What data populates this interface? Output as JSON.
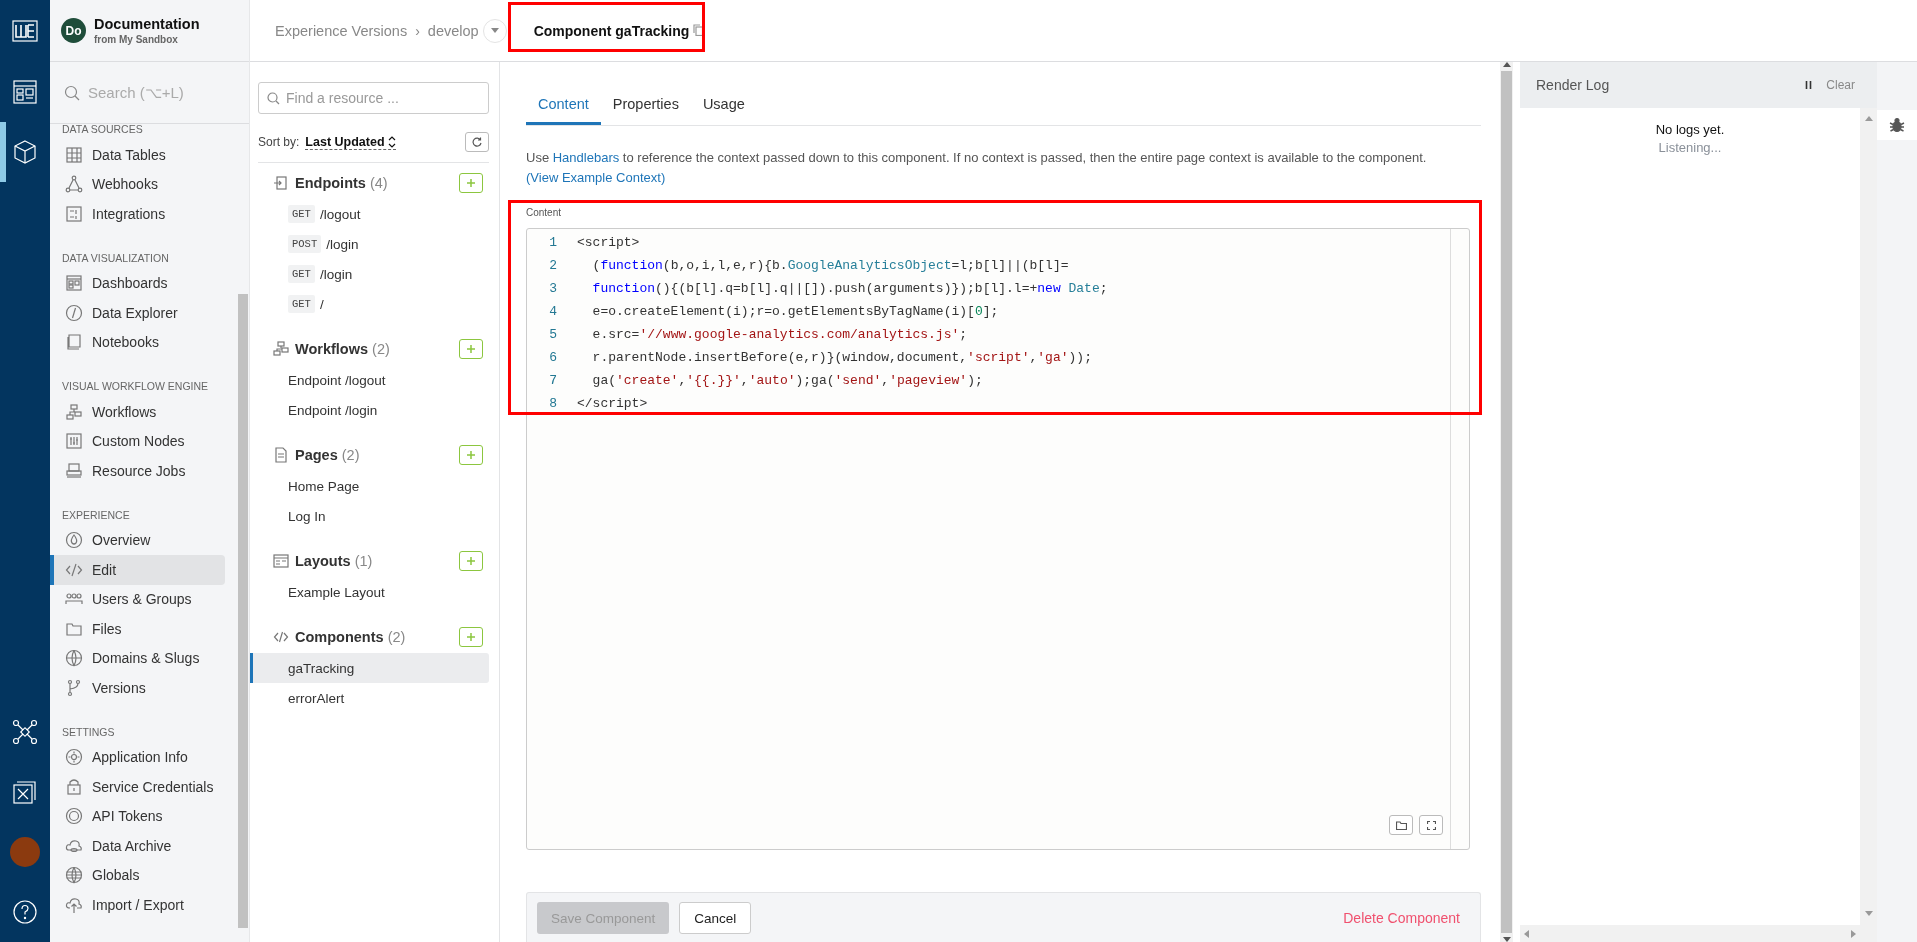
{
  "rail": {
    "items": [
      {
        "selected": false
      },
      {
        "selected": true
      }
    ]
  },
  "app": {
    "initials": "Do",
    "name": "Documentation",
    "subtitle": "from My Sandbox"
  },
  "sidebar": {
    "search": {
      "placeholder": "Search (⌥+L)"
    },
    "sections": [
      {
        "heading": "DATA SOURCES",
        "items": [
          {
            "label": "Data Tables",
            "selected": false
          },
          {
            "label": "Webhooks",
            "selected": false
          },
          {
            "label": "Integrations",
            "selected": false
          }
        ]
      },
      {
        "heading": "DATA VISUALIZATION",
        "items": [
          {
            "label": "Dashboards",
            "selected": false
          },
          {
            "label": "Data Explorer",
            "selected": false
          },
          {
            "label": "Notebooks",
            "selected": false
          }
        ]
      },
      {
        "heading": "VISUAL WORKFLOW ENGINE",
        "items": [
          {
            "label": "Workflows",
            "selected": false
          },
          {
            "label": "Custom Nodes",
            "selected": false
          },
          {
            "label": "Resource Jobs",
            "selected": false
          }
        ]
      },
      {
        "heading": "EXPERIENCE",
        "items": [
          {
            "label": "Overview",
            "selected": false
          },
          {
            "label": "Edit",
            "selected": true
          },
          {
            "label": "Users & Groups",
            "selected": false
          },
          {
            "label": "Files",
            "selected": false
          },
          {
            "label": "Domains & Slugs",
            "selected": false
          },
          {
            "label": "Versions",
            "selected": false
          }
        ]
      },
      {
        "heading": "SETTINGS",
        "items": [
          {
            "label": "Application Info",
            "selected": false
          },
          {
            "label": "Service Credentials",
            "selected": false
          },
          {
            "label": "API Tokens",
            "selected": false
          },
          {
            "label": "Data Archive",
            "selected": false
          },
          {
            "label": "Globals",
            "selected": false
          },
          {
            "label": "Import / Export",
            "selected": false
          }
        ]
      }
    ]
  },
  "breadcrumb": {
    "items": [
      "Experience Versions",
      "develop"
    ],
    "separator": "›"
  },
  "page_title": "Component gaTracking",
  "resources": {
    "search": {
      "placeholder": "Find a resource ..."
    },
    "sort_label": "Sort by:",
    "sort_value": "Last Updated",
    "groups": [
      {
        "title": "Endpoints",
        "count": "(4)",
        "items": [
          {
            "method": "GET",
            "label": "/logout",
            "selected": false
          },
          {
            "method": "POST",
            "label": "/login",
            "selected": false
          },
          {
            "method": "GET",
            "label": "/login",
            "selected": false
          },
          {
            "method": "GET",
            "label": "/",
            "selected": false
          }
        ]
      },
      {
        "title": "Workflows",
        "count": "(2)",
        "items": [
          {
            "label": "Endpoint /logout",
            "selected": false
          },
          {
            "label": "Endpoint /login",
            "selected": false
          }
        ]
      },
      {
        "title": "Pages",
        "count": "(2)",
        "items": [
          {
            "label": "Home Page",
            "selected": false
          },
          {
            "label": "Log In",
            "selected": false
          }
        ]
      },
      {
        "title": "Layouts",
        "count": "(1)",
        "items": [
          {
            "label": "Example Layout",
            "selected": false
          }
        ]
      },
      {
        "title": "Components",
        "count": "(2)",
        "items": [
          {
            "label": "gaTracking",
            "selected": true
          },
          {
            "label": "errorAlert",
            "selected": false
          }
        ]
      }
    ]
  },
  "tabs": [
    {
      "label": "Content",
      "selected": true
    },
    {
      "label": "Properties",
      "selected": false
    },
    {
      "label": "Usage",
      "selected": false
    }
  ],
  "help_text": {
    "before": "Use ",
    "link": "Handlebars",
    "after": " to reference the context passed down to this component. If no context is passed, then the entire page context is available to the component."
  },
  "example_link": "(View Example Context)",
  "editor": {
    "label": "Content",
    "lines": [
      {
        "number": "1",
        "tokens": [
          {
            "text": "<script>",
            "kind": "plain"
          }
        ]
      },
      {
        "number": "2",
        "tokens": [
          {
            "text": "  (",
            "kind": "plain"
          },
          {
            "text": "function",
            "kind": "keyword"
          },
          {
            "text": "(b,o,i,l,e,r){b.",
            "kind": "plain"
          },
          {
            "text": "GoogleAnalyticsObject",
            "kind": "type"
          },
          {
            "text": "=l;b[l]||(b[l]=",
            "kind": "plain"
          }
        ]
      },
      {
        "number": "3",
        "tokens": [
          {
            "text": "  function",
            "kind": "keyword"
          },
          {
            "text": "(){(b[l].q=b[l].q||[]).push(arguments)});b[l].l=+",
            "kind": "plain"
          },
          {
            "text": "new",
            "kind": "keyword"
          },
          {
            "text": " Date",
            "kind": "type"
          },
          {
            "text": ";",
            "kind": "plain"
          }
        ]
      },
      {
        "number": "4",
        "tokens": [
          {
            "text": "  e=o.createElement(i);r=o.getElementsByTagName(i)[",
            "kind": "plain"
          },
          {
            "text": "0",
            "kind": "number"
          },
          {
            "text": "];",
            "kind": "plain"
          }
        ]
      },
      {
        "number": "5",
        "tokens": [
          {
            "text": "  e.src=",
            "kind": "plain"
          },
          {
            "text": "'//www.google-analytics.com/analytics.js'",
            "kind": "string"
          },
          {
            "text": ";",
            "kind": "plain"
          }
        ]
      },
      {
        "number": "6",
        "tokens": [
          {
            "text": "  r.parentNode.insertBefore(e,r)}(window,document,",
            "kind": "plain"
          },
          {
            "text": "'script'",
            "kind": "string"
          },
          {
            "text": ",",
            "kind": "plain"
          },
          {
            "text": "'ga'",
            "kind": "string"
          },
          {
            "text": "));",
            "kind": "plain"
          }
        ]
      },
      {
        "number": "7",
        "tokens": [
          {
            "text": "  ga(",
            "kind": "plain"
          },
          {
            "text": "'create'",
            "kind": "string"
          },
          {
            "text": ",",
            "kind": "plain"
          },
          {
            "text": "'{{.}}'",
            "kind": "string"
          },
          {
            "text": ",",
            "kind": "plain"
          },
          {
            "text": "'auto'",
            "kind": "string"
          },
          {
            "text": ");ga(",
            "kind": "plain"
          },
          {
            "text": "'send'",
            "kind": "string"
          },
          {
            "text": ",",
            "kind": "plain"
          },
          {
            "text": "'pageview'",
            "kind": "string"
          },
          {
            "text": ");",
            "kind": "plain"
          }
        ]
      },
      {
        "number": "8",
        "tokens": [
          {
            "text": "</script>",
            "kind": "plain"
          }
        ]
      }
    ]
  },
  "actions": {
    "save": {
      "label": "Save Component",
      "disabled": true
    },
    "cancel": "Cancel",
    "delete": "Delete Component"
  },
  "render_log": {
    "title": "Render Log",
    "clear": "Clear",
    "empty_title": "No logs yet.",
    "empty_subtitle": "Listening..."
  }
}
